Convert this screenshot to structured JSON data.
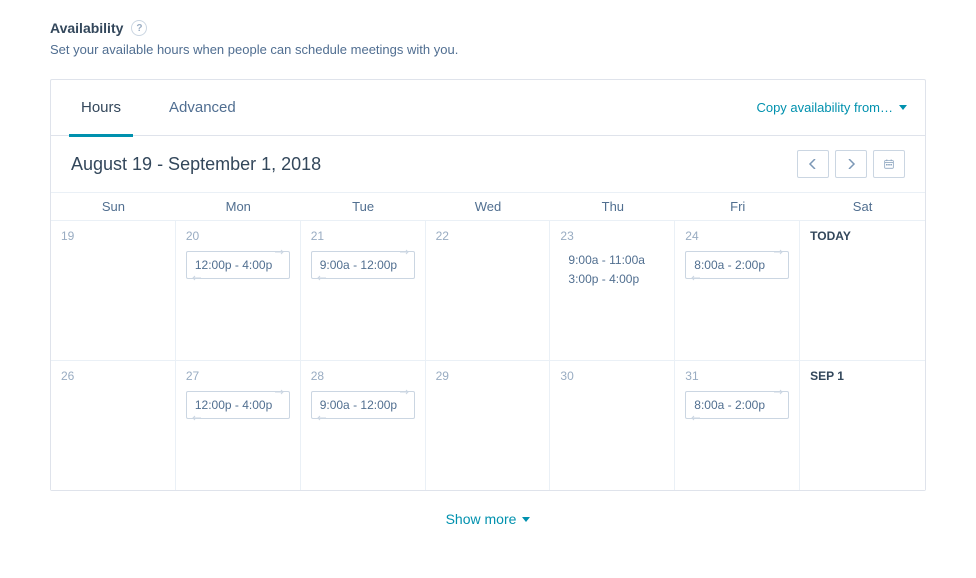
{
  "section": {
    "title": "Availability",
    "help_glyph": "?",
    "description": "Set your available hours when people can schedule meetings with you."
  },
  "tabs": {
    "hours": "Hours",
    "advanced": "Advanced"
  },
  "copy_link": "Copy availability from…",
  "range_title": "August 19 - September 1, 2018",
  "days": {
    "sun": "Sun",
    "mon": "Mon",
    "tue": "Tue",
    "wed": "Wed",
    "thu": "Thu",
    "fri": "Fri",
    "sat": "Sat"
  },
  "week1": {
    "sun": {
      "num": "19"
    },
    "mon": {
      "num": "20",
      "slot": "12:00p - 4:00p"
    },
    "tue": {
      "num": "21",
      "slot": "9:00a - 12:00p"
    },
    "wed": {
      "num": "22"
    },
    "thu": {
      "num": "23",
      "line1": "9:00a - 11:00a",
      "line2": "3:00p - 4:00p"
    },
    "fri": {
      "num": "24",
      "slot": "8:00a - 2:00p"
    },
    "sat": {
      "num": "TODAY"
    }
  },
  "week2": {
    "sun": {
      "num": "26"
    },
    "mon": {
      "num": "27",
      "slot": "12:00p - 4:00p"
    },
    "tue": {
      "num": "28",
      "slot": "9:00a - 12:00p"
    },
    "wed": {
      "num": "29"
    },
    "thu": {
      "num": "30"
    },
    "fri": {
      "num": "31",
      "slot": "8:00a - 2:00p"
    },
    "sat": {
      "num": "SEP 1"
    }
  },
  "show_more": "Show more"
}
